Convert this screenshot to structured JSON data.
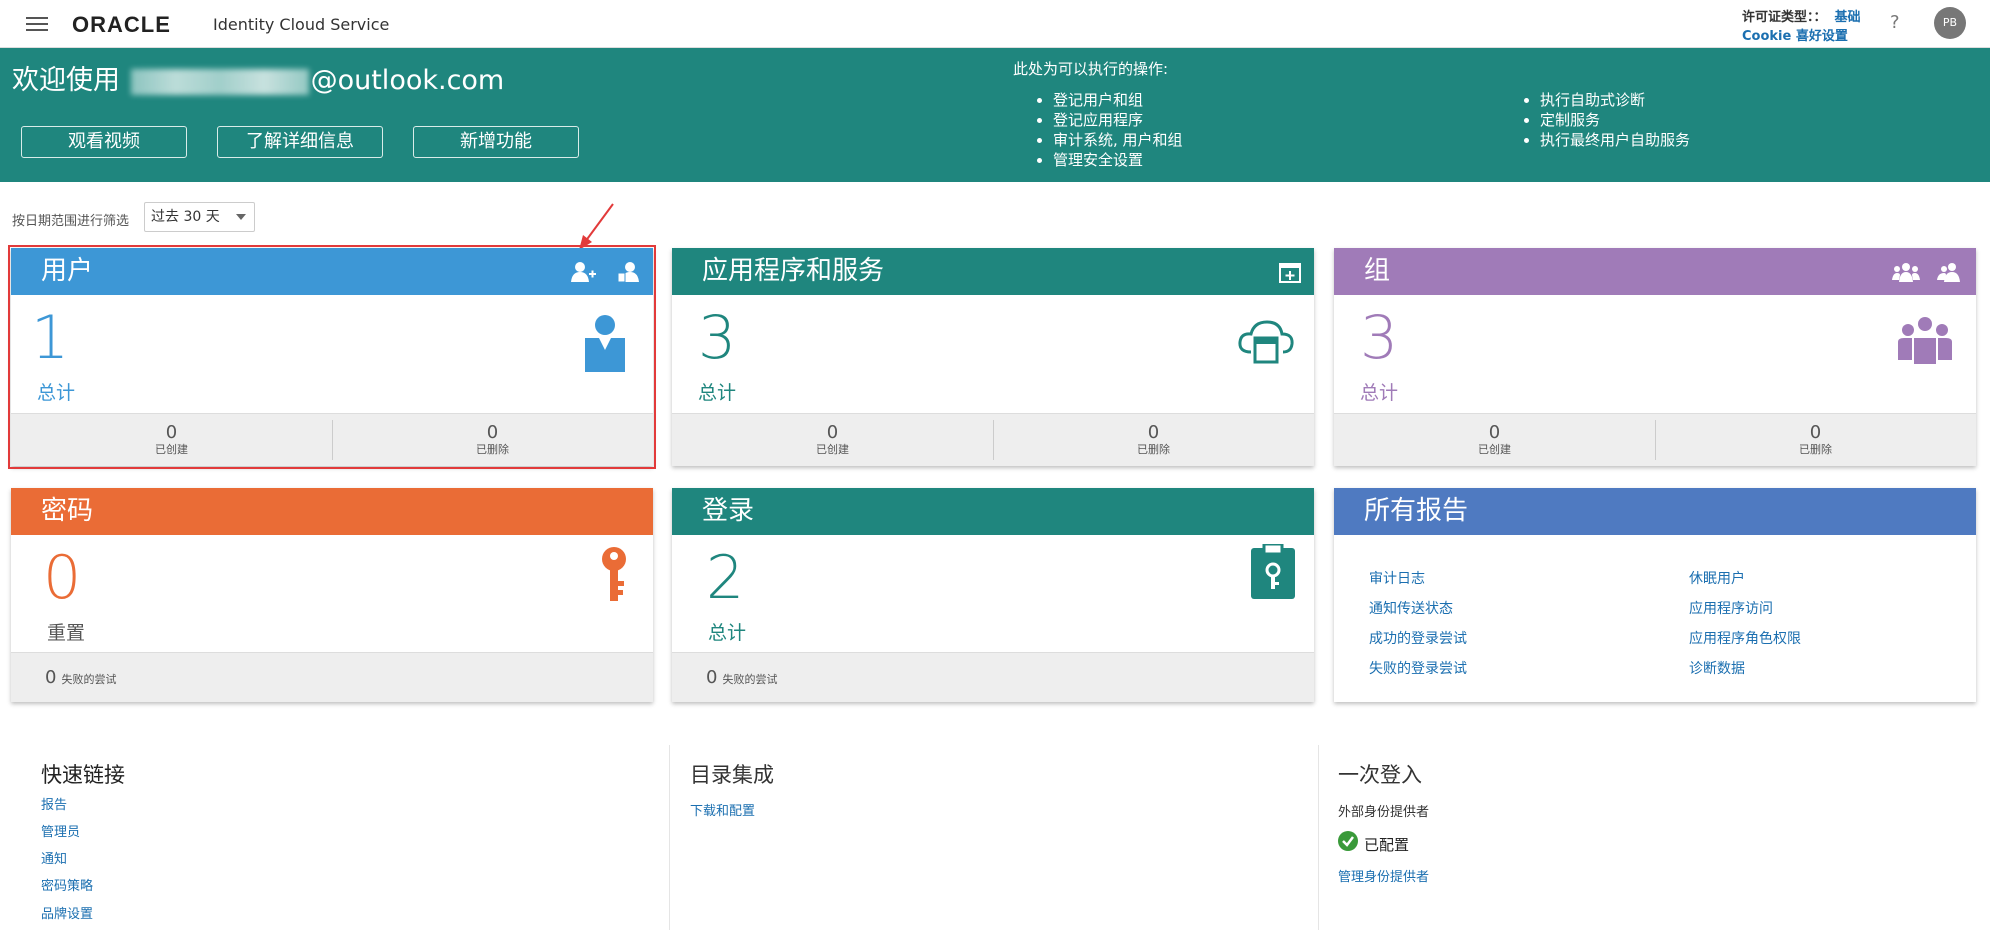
{
  "header": {
    "logo": "ORACLE",
    "product": "Identity Cloud Service",
    "license_label": "许可证类型：：",
    "license_value": "基础",
    "cookie": "Cookie 喜好设置",
    "help": "?",
    "avatar": "PB"
  },
  "banner": {
    "welcome_prefix": "欢迎使用 ",
    "welcome_suffix": "@outlook.com",
    "buttons": [
      "观看视频",
      "了解详细信息",
      "新增功能"
    ],
    "actions_title": "此处为可以执行的操作:",
    "actions_col1": [
      "登记用户和组",
      "登记应用程序",
      "审计系统, 用户和组",
      "管理安全设置"
    ],
    "actions_col2": [
      "执行自助式诊断",
      "定制服务",
      "执行最终用户自助服务"
    ]
  },
  "filter": {
    "label": "按日期范围进行筛选",
    "value": "过去 30 天"
  },
  "cards": {
    "users": {
      "title": "用户",
      "value": "1",
      "total_label": "总计",
      "created": "0",
      "created_label": "已创建",
      "deleted": "0",
      "deleted_label": "已删除",
      "color": "#3d97d6"
    },
    "apps": {
      "title": "应用程序和服务",
      "value": "3",
      "total_label": "总计",
      "created": "0",
      "created_label": "已创建",
      "deleted": "0",
      "deleted_label": "已删除",
      "color": "#1f867e"
    },
    "groups": {
      "title": "组",
      "value": "3",
      "total_label": "总计",
      "created": "0",
      "created_label": "已创建",
      "deleted": "0",
      "deleted_label": "已删除",
      "color": "#a07bb8"
    },
    "password": {
      "title": "密码",
      "value": "0",
      "total_label": "重置",
      "failed": "0",
      "failed_label": "失败的尝试",
      "color": "#ea6c36"
    },
    "login": {
      "title": "登录",
      "value": "2",
      "total_label": "总计",
      "failed": "0",
      "failed_label": "失败的尝试",
      "color": "#1f867e"
    },
    "reports": {
      "title": "所有报告",
      "color": "#4f7ac1",
      "col1": [
        "审计日志",
        "通知传送状态",
        "成功的登录尝试",
        "失败的登录尝试"
      ],
      "col2": [
        "休眠用户",
        "应用程序访问",
        "应用程序角色权限",
        "诊断数据"
      ]
    }
  },
  "quick_links": {
    "title": "快速链接",
    "items": [
      "报告",
      "管理员",
      "通知",
      "密码策略",
      "品牌设置"
    ]
  },
  "directory": {
    "title": "目录集成",
    "link": "下载和配置"
  },
  "sso": {
    "title": "一次登入",
    "subtitle": "外部身份提供者",
    "status": "已配置",
    "link": "管理身份提供者"
  }
}
